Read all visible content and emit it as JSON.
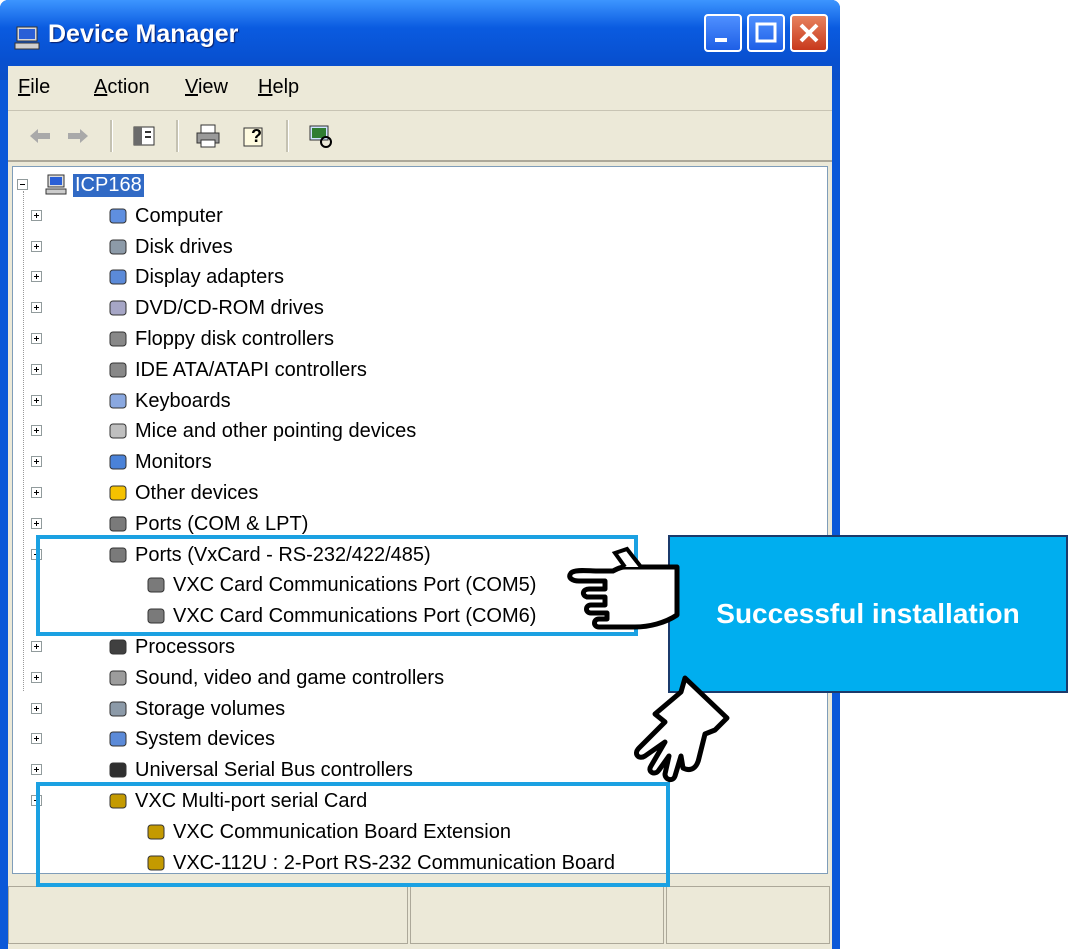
{
  "window": {
    "title": "Device Manager"
  },
  "menu": [
    "File",
    "Action",
    "View",
    "Help"
  ],
  "toolbar": [
    "back-arrow-icon",
    "forward-arrow-icon",
    "show-hide-console-tree-icon",
    "print-icon",
    "help-icon",
    "scan-hardware-icon"
  ],
  "tree": {
    "root": "ICP168",
    "categories": [
      "Computer",
      "Disk drives",
      "Display adapters",
      "DVD/CD-ROM drives",
      "Floppy disk controllers",
      "IDE ATA/ATAPI controllers",
      "Keyboards",
      "Mice and other pointing devices",
      "Monitors",
      "Other devices",
      "Ports (COM & LPT)",
      "Ports (VxCard - RS-232/422/485)",
      "Processors",
      "Sound, video and game controllers",
      "Storage volumes",
      "System devices",
      "Universal Serial Bus controllers",
      "VXC Multi-port serial Card"
    ],
    "vx_ports": [
      "VXC Card Communications Port (COM5)",
      "VXC Card Communications Port (COM6)"
    ],
    "vxc_boards": [
      "VXC Communication Board Extension",
      "VXC-112U : 2-Port RS-232 Communication Board"
    ]
  },
  "annotation": {
    "callout_text": "Successful installation",
    "highlight_color": "#1ba1e2",
    "callout_color": "#00aeef"
  }
}
